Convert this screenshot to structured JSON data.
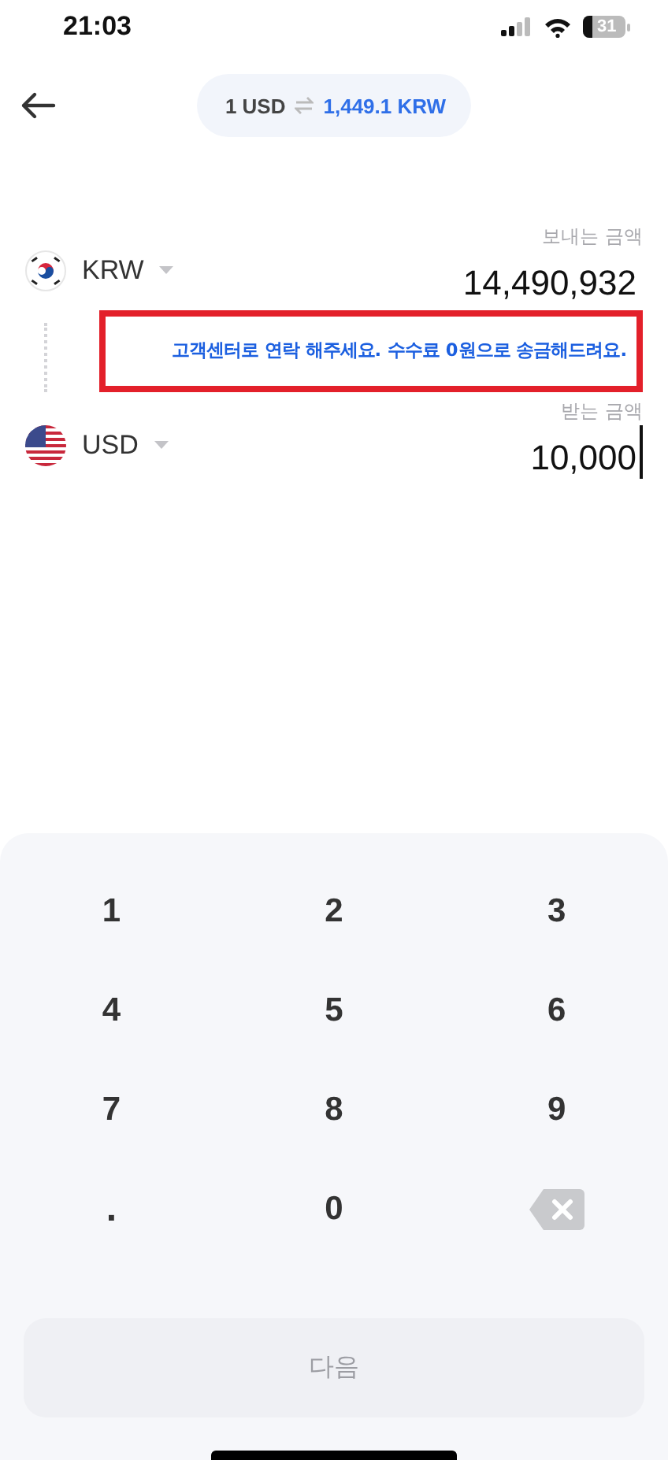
{
  "status_bar": {
    "time": "21:03",
    "battery": "31"
  },
  "rate": {
    "base": "1 USD",
    "quote": "1,449.1 KRW"
  },
  "currencies": [
    {
      "kind": "kr",
      "code": "KRW",
      "label": "보내는 금액",
      "amount": "14,490,932",
      "focused": false
    },
    {
      "kind": "us",
      "code": "USD",
      "label": "받는 금액",
      "amount": "10,000",
      "focused": true
    }
  ],
  "notice": {
    "text": "고객센터로 연락 해주세요. 수수료 0원으로 송금해드려요.",
    "highlighted": true
  },
  "keypad": [
    {
      "kind": "digit",
      "label": "1"
    },
    {
      "kind": "digit",
      "label": "2"
    },
    {
      "kind": "digit",
      "label": "3"
    },
    {
      "kind": "digit",
      "label": "4"
    },
    {
      "kind": "digit",
      "label": "5"
    },
    {
      "kind": "digit",
      "label": "6"
    },
    {
      "kind": "digit",
      "label": "7"
    },
    {
      "kind": "digit",
      "label": "8"
    },
    {
      "kind": "digit",
      "label": "9"
    },
    {
      "kind": "dot",
      "label": "."
    },
    {
      "kind": "digit",
      "label": "0"
    },
    {
      "kind": "backspace"
    }
  ],
  "next_button": {
    "label": "다음",
    "disabled": true
  }
}
